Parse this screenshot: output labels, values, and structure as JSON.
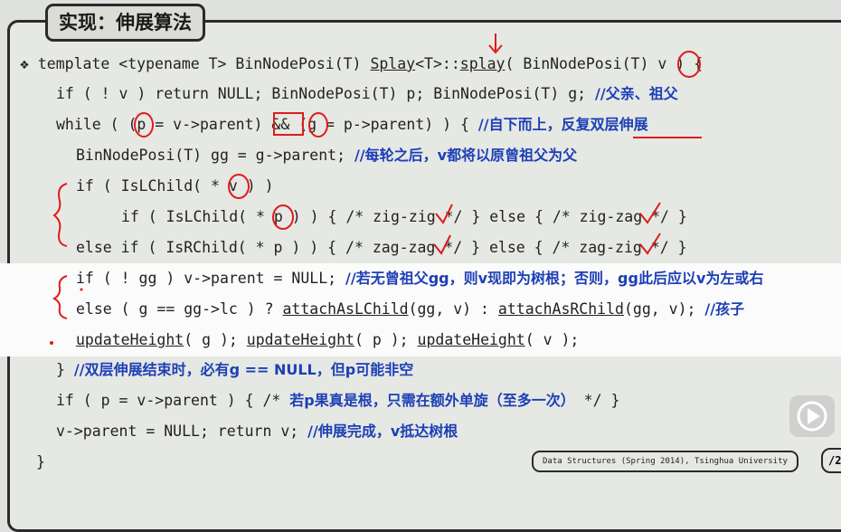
{
  "slide": {
    "title": "实现：伸展算法",
    "footer": "Data Structures (Spring 2014), Tsinghua University",
    "page_number_partial": "/2"
  },
  "code": {
    "bullet": "❖",
    "l1": {
      "pre": "template <typename T> BinNodePosi(T) ",
      "splay1": "Splay",
      "mid": "<T>::",
      "splay2": "splay",
      "post": "( BinNodePosi(T) v ) {"
    },
    "l2": {
      "code": "if ( ! v ) return NULL; BinNodePosi(T) p; BinNodePosi(T) g; ",
      "comment": "//父亲、祖父"
    },
    "l3": {
      "code": "while ( (p = v->parent) && (g = p->parent) ) { ",
      "comment": "//自下而上，反复双层伸展"
    },
    "l4": {
      "code": "BinNodePosi(T) gg = g->parent; ",
      "comment": "//每轮之后，v都将以原曾祖父为父"
    },
    "l5": {
      "code": "if ( IsLChild( * v ) )"
    },
    "l6": {
      "code": "if ( IsLChild( * p ) ) { /* zig-zig */ } else { /* zig-zag */ }"
    },
    "l7": {
      "code": "else if ( IsRChild( * p ) ) { /* zag-zag */ } else { /* zag-zig */ }"
    },
    "l8": {
      "code": "if ( ! gg ) v->parent = NULL; ",
      "comment": "//若无曾祖父gg，则v现即为树根；否则，gg此后应以v为左或右"
    },
    "l9": {
      "pre": "else ( g == gg->lc ) ? ",
      "f1": "attachAsLChild",
      "mid": "(gg, v) : ",
      "f2": "attachAsRChild",
      "post": "(gg, v); ",
      "comment": "//孩子"
    },
    "l10": {
      "f": "updateHeight",
      "a1": "( g ); ",
      "a2": "( p ); ",
      "a3": "( v );"
    },
    "l11": {
      "code": "} ",
      "comment": "//双层伸展结束时，必有g == NULL，但p可能非空"
    },
    "l12": {
      "code": "if ( p = v->parent ) { /* ",
      "comment": "若p果真是根，只需在额外单旋（至多一次）",
      "post": " */ }"
    },
    "l13": {
      "code": "v->parent = NULL; return v; ",
      "comment": "//伸展完成，v抵达树根"
    },
    "l14": {
      "code": "}"
    }
  },
  "colors": {
    "code": "#222222",
    "comment": "#1c3fb5",
    "annotation": "#e01b1b",
    "highlight": "#fbfbfb"
  },
  "icons": {
    "bullet": "diamond-bullet-icon",
    "player": "video-play-icon"
  }
}
